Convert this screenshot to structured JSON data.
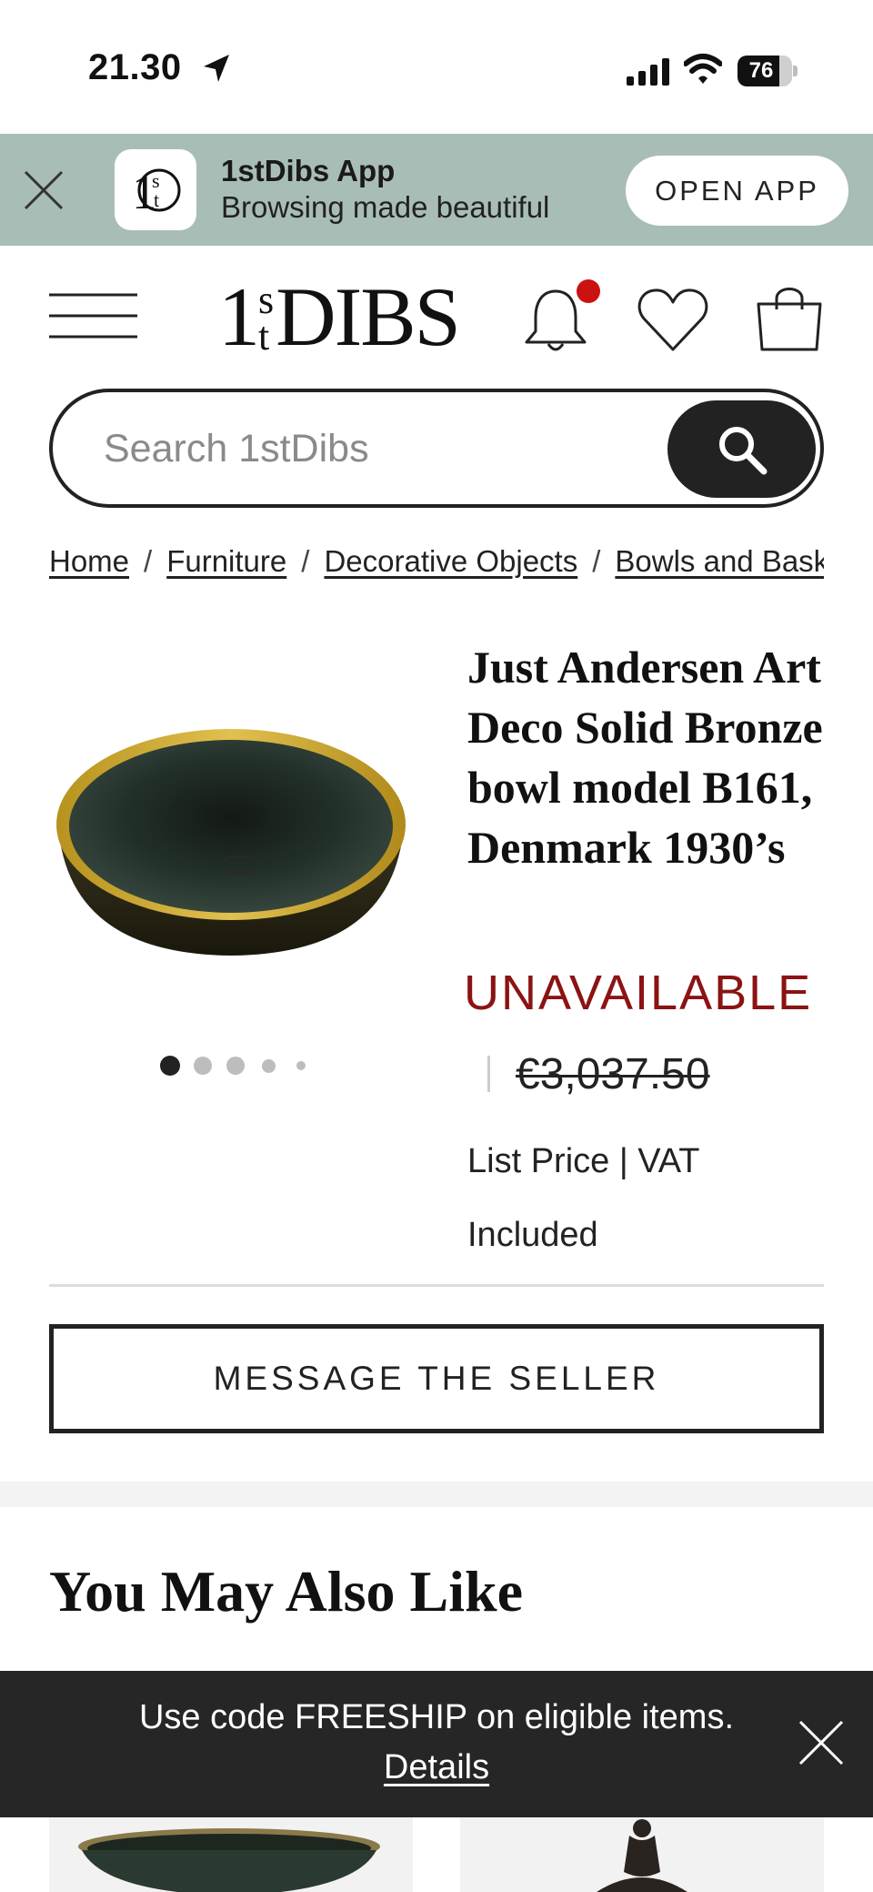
{
  "status_bar": {
    "time": "21.30",
    "battery_level": "76",
    "icons": [
      "location-arrow-icon",
      "cellular-signal-icon",
      "wifi-icon",
      "battery-icon"
    ]
  },
  "app_banner": {
    "title": "1stDibs App",
    "subtitle": "Browsing made beautiful",
    "open_label": "OPEN APP",
    "icons": [
      "close-icon",
      "app-logo-icon"
    ]
  },
  "header": {
    "logo_one": "1",
    "logo_s": "s",
    "logo_t": "t",
    "logo_dibs": "DIBS",
    "icons": [
      "menu-icon",
      "bell-icon",
      "heart-icon",
      "shopping-bag-icon"
    ],
    "has_notification": true
  },
  "search": {
    "placeholder": "Search 1stDibs"
  },
  "breadcrumb": {
    "items": [
      "Home",
      "Furniture",
      "Decorative Objects",
      "Bowls and Baskets"
    ],
    "separator": "/"
  },
  "product": {
    "title": "Just Andersen Art Deco Solid Bronze bowl model B161, Denmark 1930’s",
    "availability": "UNAVAILABLE",
    "price": "€3,037.50",
    "price_note": "List Price | VAT Included",
    "image_count": 5,
    "active_image": 1,
    "message_button": "MESSAGE THE SELLER"
  },
  "recommendations": {
    "heading": "You May Also Like"
  },
  "promo": {
    "text": "Use code FREESHIP on eligible items.",
    "link": "Details"
  },
  "colors": {
    "banner_bg": "#a9bdb7",
    "unavailable": "#8b1313",
    "notification_dot": "#cc1111",
    "promo_bg": "#262626"
  }
}
